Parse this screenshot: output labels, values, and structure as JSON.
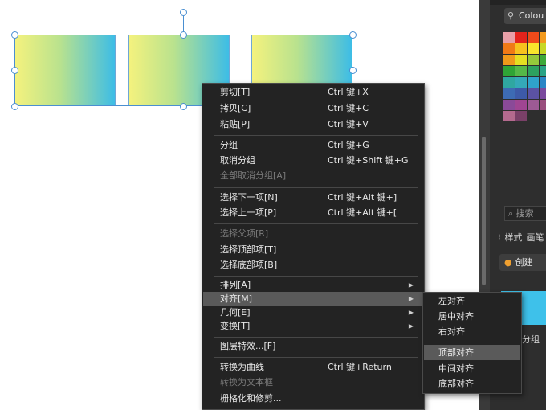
{
  "context_menu": {
    "items": [
      {
        "label": "剪切[T]",
        "shortcut": "Ctrl 键+X"
      },
      {
        "label": "拷贝[C]",
        "shortcut": "Ctrl 键+C"
      },
      {
        "label": "粘贴[P]",
        "shortcut": "Ctrl 键+V"
      },
      {
        "label": "分组",
        "shortcut": "Ctrl 键+G"
      },
      {
        "label": "取消分组",
        "shortcut": "Ctrl 键+Shift 键+G"
      },
      {
        "label": "全部取消分组[A]",
        "disabled": true
      },
      {
        "label": "选择下一项[N]",
        "shortcut": "Ctrl 键+Alt 键+]"
      },
      {
        "label": "选择上一项[P]",
        "shortcut": "Ctrl 键+Alt 键+["
      },
      {
        "label": "选择父项[R]",
        "disabled": true
      },
      {
        "label": "选择顶部项[T]"
      },
      {
        "label": "选择底部项[B]"
      },
      {
        "label": "排列[A]",
        "submenu": true
      },
      {
        "label": "对齐[M]",
        "submenu": true,
        "highlighted": true
      },
      {
        "label": "几何[E]",
        "submenu": true
      },
      {
        "label": "变换[T]",
        "submenu": true
      },
      {
        "label": "图层特效...[F]"
      },
      {
        "label": "转换为曲线",
        "shortcut": "Ctrl 键+Return"
      },
      {
        "label": "转换为文本框",
        "disabled": true
      },
      {
        "label": "栅格化和修剪..."
      }
    ],
    "submenu_arrow": "▶"
  },
  "align_submenu": {
    "items": [
      {
        "label": "左对齐"
      },
      {
        "label": "居中对齐"
      },
      {
        "label": "右对齐"
      },
      {
        "label": "顶部对齐",
        "highlighted": true
      },
      {
        "label": "中间对齐"
      },
      {
        "label": "底部对齐"
      }
    ]
  },
  "right_panel": {
    "colour_tab_label": "Colou",
    "colour_tab_icon": "eyedropper-icon",
    "search_placeholder": "搜索",
    "search_icon": "magnifier-icon",
    "tabs_label_1": "样式",
    "tabs_label_2": "画笔",
    "create_button_label": "创建",
    "create_icon": "orange-circle-icon",
    "layer_label": "分组",
    "swatch_colors": [
      "#e8a0a8",
      "#e4231c",
      "#ef4a1a",
      "#f39a1e",
      "#f07a16",
      "#f7c21e",
      "#f9e62c",
      "#c8d826",
      "#ef9a1a",
      "#e4df22",
      "#95c93b",
      "#3ea93a",
      "#2fa436",
      "#55b848",
      "#2da160",
      "#2aa386",
      "#2fa7a1",
      "#34a9b8",
      "#2fa3cb",
      "#2a86c6",
      "#3d6bb4",
      "#3d5aa8",
      "#5b52a3",
      "#7a4a9e",
      "#8a4a98",
      "#a04592",
      "#9d5a94",
      "#9a4e7e",
      "#b46a8e",
      "#7a4068"
    ]
  },
  "colors": {
    "menu_bg": "#232323",
    "menu_highlight": "#5a5a5a",
    "selection": "#4a8fd1",
    "panel_bg": "#2e2e2e"
  }
}
